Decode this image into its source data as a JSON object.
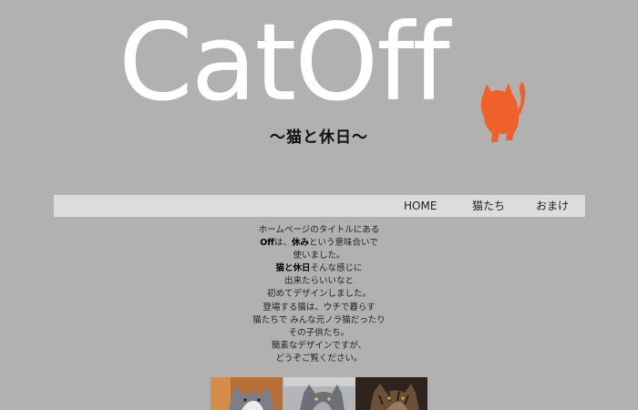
{
  "header": {
    "logo_text": "CatOff",
    "subtitle": "～猫と休日～"
  },
  "nav": {
    "items": [
      {
        "label": "HOME"
      },
      {
        "label": "猫たち"
      },
      {
        "label": "おまけ"
      }
    ]
  },
  "intro": {
    "line1": "ホームページのタイトルにある",
    "line2_bold1": "Off",
    "line2_mid": "は、",
    "line2_bold2": "休み",
    "line2_end": "という意味合いで",
    "line3": "使いました。",
    "line4_bold": "猫と休日",
    "line4_end": "そんな感じに",
    "line5": "出来たらいいなと",
    "line6": "初めてデザインしました。",
    "line7": "登場する猫は、ウチで暮らす",
    "line8": "猫たちで みんな元ノラ猫だったり",
    "line9": "その子供たち。",
    "line10": "簡素なデザインですが、",
    "line11": "どうぞご覧ください。"
  },
  "photos": [
    {
      "name": "cat-photo-gray-white",
      "colors": [
        "#c9843f",
        "#7f7f86",
        "#e6e6e6"
      ]
    },
    {
      "name": "cat-photo-gray",
      "colors": [
        "#a7a9aa",
        "#6e7176",
        "#d6d6d6"
      ]
    },
    {
      "name": "cat-photo-tabby",
      "colors": [
        "#3a2b22",
        "#8a6a4c",
        "#5c4633"
      ]
    }
  ],
  "colors": {
    "background": "#b1b1b1",
    "logo": "#ffffff",
    "cat_accent": "#f0602a",
    "nav_bg": "#dcdcdc"
  }
}
